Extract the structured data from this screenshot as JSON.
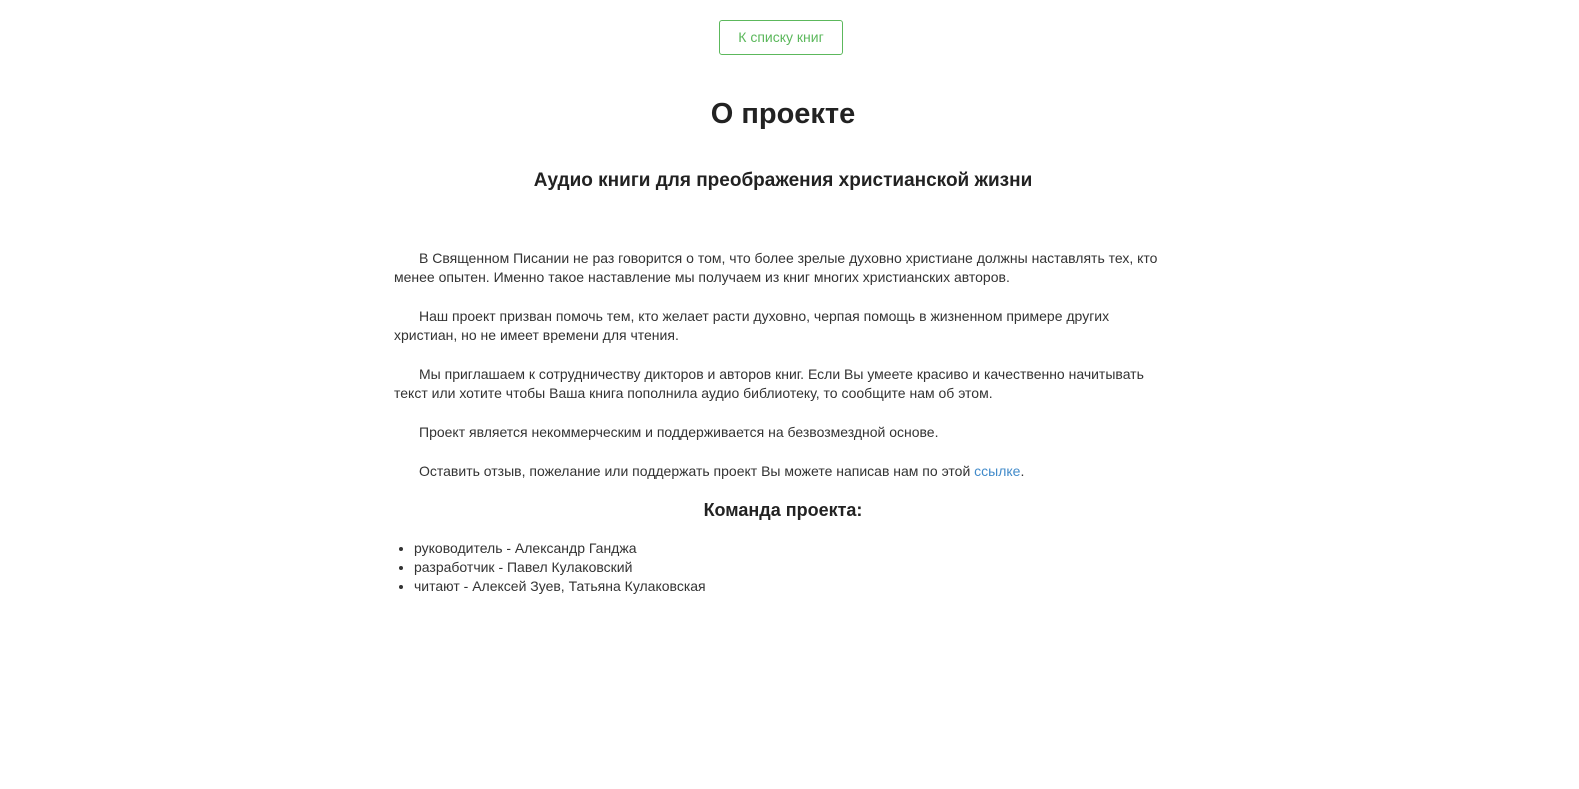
{
  "nav": {
    "back_label": "К списку книг"
  },
  "page": {
    "title": "О проекте",
    "subtitle": "Аудио книги для преображения христианской жизни"
  },
  "content": {
    "paragraphs": [
      "В Священном Писании не раз говорится о том, что более зрелые духовно христиане должны наставлять тех, кто менее опытен. Именно такое наставление мы получаем из книг многих христианских авторов.",
      "Наш проект призван помочь тем, кто желает расти духовно, черпая помощь в жизненном примере других христиан, но не имеет времени для чтения.",
      "Мы приглашаем к сотрудничеству дикторов и авторов книг. Если Вы умеете красиво и качественно начитывать текст или хотите чтобы Ваша книга пополнила аудио библиотеку, то сообщите нам об этом.",
      "Проект является некоммерческим и поддерживается на безвозмездной основе."
    ],
    "feedback_prefix": "Оставить отзыв, пожелание или поддержать проект Вы можете написав нам по этой ",
    "feedback_link": "ссылке",
    "feedback_suffix": "."
  },
  "team": {
    "title": "Команда проекта:",
    "members": [
      "руководитель - Александр Ганджа",
      "разработчик - Павел Кулаковский",
      "читают - Алексей Зуев, Татьяна Кулаковская"
    ]
  },
  "colors": {
    "accent": "#5cb85c",
    "link": "#428bca",
    "text": "#333333",
    "heading": "#222222"
  }
}
